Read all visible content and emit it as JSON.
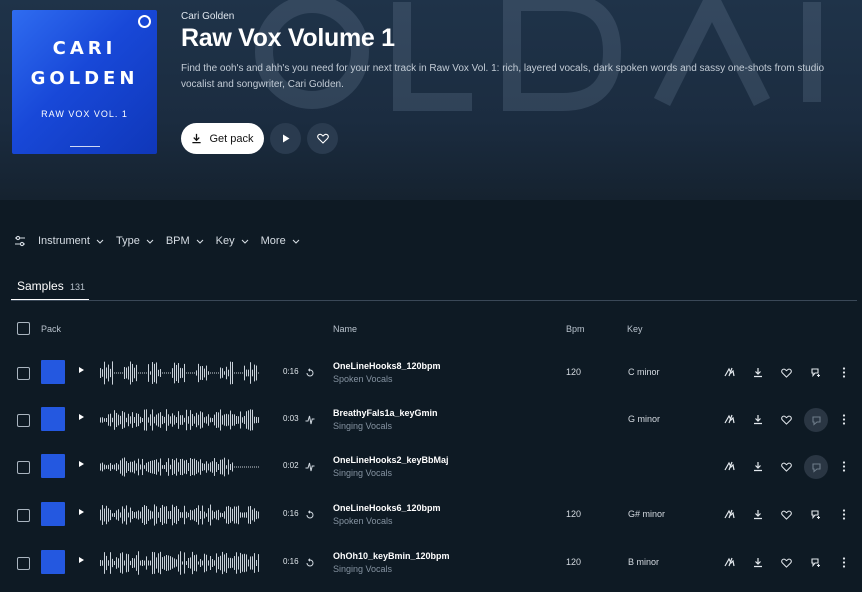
{
  "pack": {
    "cover": {
      "line1": "CARI",
      "line2": "GOLDEN",
      "line3": "RAW VOX VOL. 1"
    },
    "artist": "Cari Golden",
    "title": "Raw Vox Volume 1",
    "description": "Find the ooh's and ahh's you need for your next track in Raw Vox Vol. 1: rich, layered vocals, dark spoken words and sassy one-shots from studio vocalist and songwriter, Cari Golden.",
    "get_label": "Get pack"
  },
  "filters": [
    {
      "label": "Instrument"
    },
    {
      "label": "Type"
    },
    {
      "label": "BPM"
    },
    {
      "label": "Key"
    },
    {
      "label": "More"
    }
  ],
  "tabs": {
    "samples_label": "Samples",
    "samples_count": "131"
  },
  "columns": {
    "pack": "Pack",
    "name": "Name",
    "bpm": "Bpm",
    "key": "Key"
  },
  "rows": [
    {
      "duration": "0:16",
      "type": "loop",
      "name": "OneLineHooks8_120bpm",
      "tags": "Spoken  Vocals",
      "bpm": "120",
      "key": "C minor",
      "match_disabled": false
    },
    {
      "duration": "0:03",
      "type": "oneshot",
      "name": "BreathyFals1a_keyGmin",
      "tags": "Singing  Vocals",
      "bpm": "",
      "key": "G minor",
      "match_disabled": true
    },
    {
      "duration": "0:02",
      "type": "oneshot",
      "name": "OneLineHooks2_keyBbMaj",
      "tags": "Singing  Vocals",
      "bpm": "",
      "key": "",
      "match_disabled": true
    },
    {
      "duration": "0:16",
      "type": "loop",
      "name": "OneLineHooks6_120bpm",
      "tags": "Spoken  Vocals",
      "bpm": "120",
      "key": "G# minor",
      "match_disabled": false
    },
    {
      "duration": "0:16",
      "type": "loop",
      "name": "OhOh10_keyBmin_120bpm",
      "tags": "Singing  Vocals",
      "bpm": "120",
      "key": "B minor",
      "match_disabled": false
    }
  ],
  "colors": {
    "accent": "#2458e0",
    "background": "#0e1a24",
    "header": "#1f3349"
  }
}
